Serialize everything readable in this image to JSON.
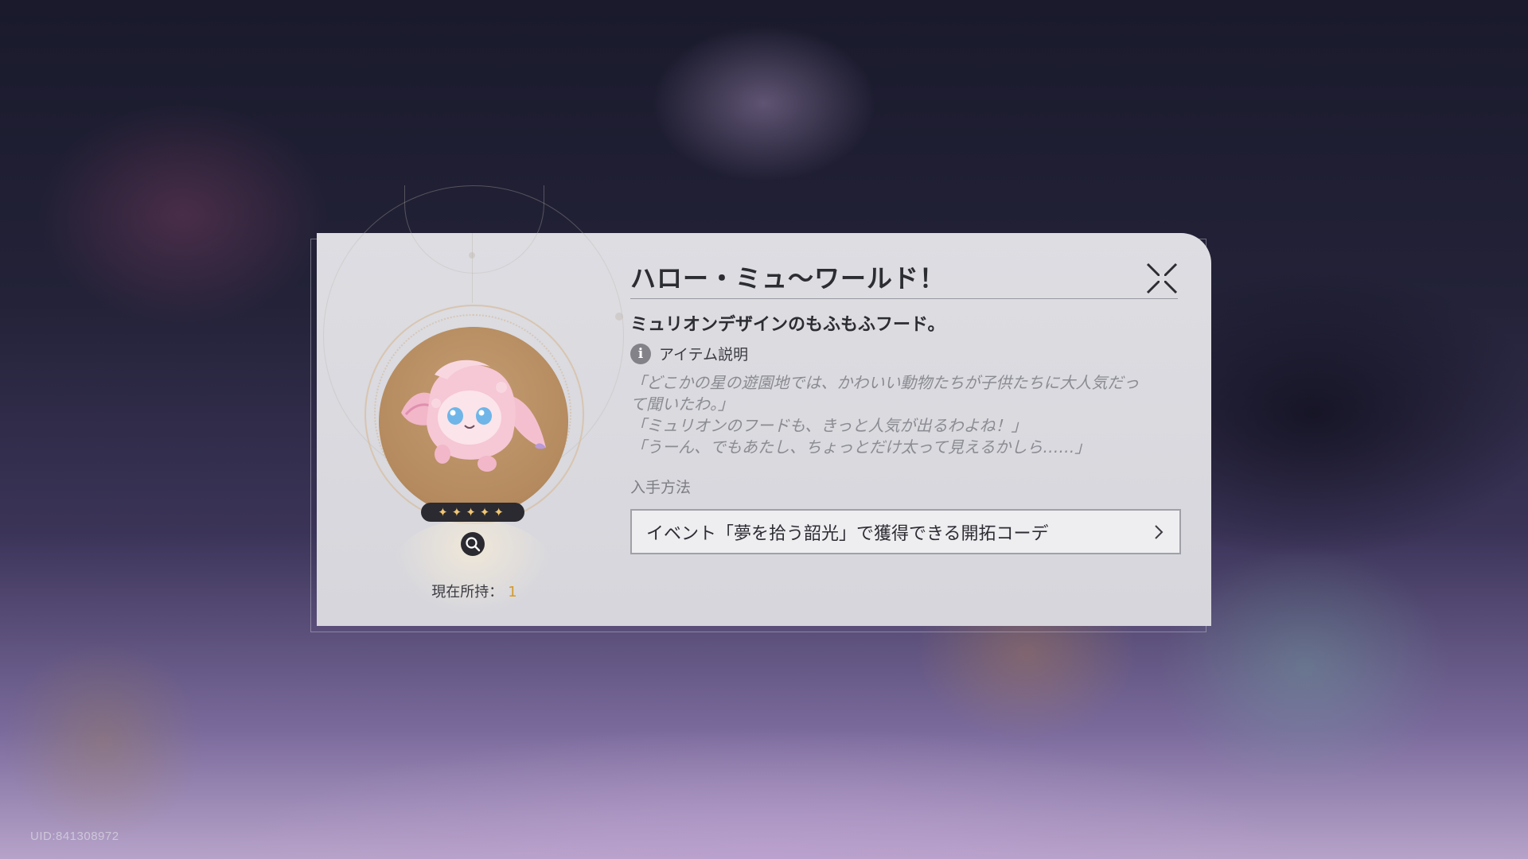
{
  "item": {
    "title": "ハロー・ミュ〜ワールド！",
    "subtitle": "ミュリオンデザインのもふもふフード。",
    "description_heading": "アイテム説明",
    "description_lines": [
      "「どこかの星の遊園地では、かわいい動物たちが子供たちに大人気だっ",
      "て聞いたわ。」",
      "「ミュリオンのフードも、きっと人気が出るわよね！」",
      "「うーん、でもあたし、ちょっとだけ太って見えるかしら……」"
    ],
    "rarity_stars": "✦✦✦✦✦",
    "owned_label": "現在所持：",
    "owned_count": "1"
  },
  "obtain": {
    "heading": "入手方法",
    "source": "イベント「夢を拾う韶光」で獲得できる開拓コーデ"
  },
  "footer": {
    "uid": "UID:841308972"
  },
  "icons": {
    "close": "close-icon",
    "info": "info-icon",
    "zoom": "magnifier-icon",
    "chevron": "chevron-right-icon"
  },
  "colors": {
    "panel": "#dddde2",
    "owned_count": "#d39a2c",
    "rarity_star": "#f0c674"
  }
}
